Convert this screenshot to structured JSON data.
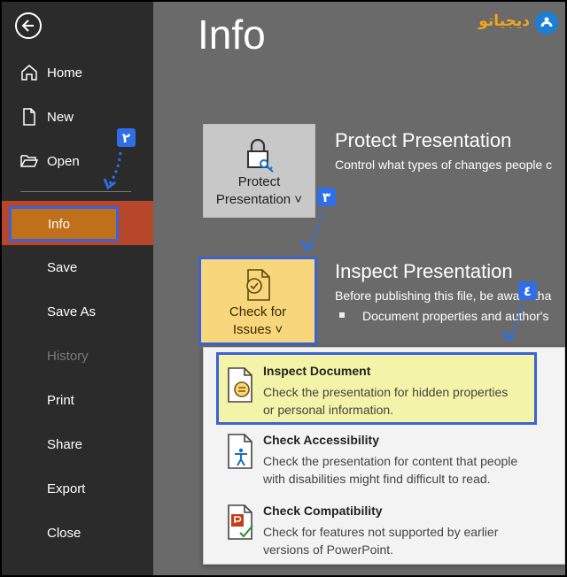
{
  "sidebar": {
    "items": [
      {
        "label": "Home"
      },
      {
        "label": "New"
      },
      {
        "label": "Open"
      },
      {
        "label": "Info"
      },
      {
        "label": "Save"
      },
      {
        "label": "Save As"
      },
      {
        "label": "History"
      },
      {
        "label": "Print"
      },
      {
        "label": "Share"
      },
      {
        "label": "Export"
      },
      {
        "label": "Close"
      }
    ]
  },
  "main": {
    "title": "Info",
    "protect": {
      "button_line1": "Protect",
      "button_line2": "Presentation ˅",
      "title": "Protect Presentation",
      "desc": "Control what types of changes people c"
    },
    "inspect": {
      "button_line1": "Check for",
      "button_line2": "Issues ˅",
      "title": "Inspect Presentation",
      "desc": "Before publishing this file, be aware tha",
      "bullet": "Document properties and author's"
    }
  },
  "menu": {
    "items": [
      {
        "title": "Inspect Document",
        "desc1": "Check the presentation for hidden properties",
        "desc2": "or personal information."
      },
      {
        "title": "Check Accessibility",
        "desc1": "Check the presentation for content that people",
        "desc2": "with disabilities might find difficult to read."
      },
      {
        "title": "Check Compatibility",
        "desc1": "Check for features not supported by earlier",
        "desc2": "versions of PowerPoint."
      }
    ]
  },
  "badges": {
    "b2": "٢",
    "b3": "٣",
    "b4": "٤"
  },
  "logo": {
    "text": "دیجیاتو"
  },
  "colors": {
    "accent": "#b7472a",
    "highlight_border": "#3b62d6",
    "badge": "#2f6ee6"
  }
}
